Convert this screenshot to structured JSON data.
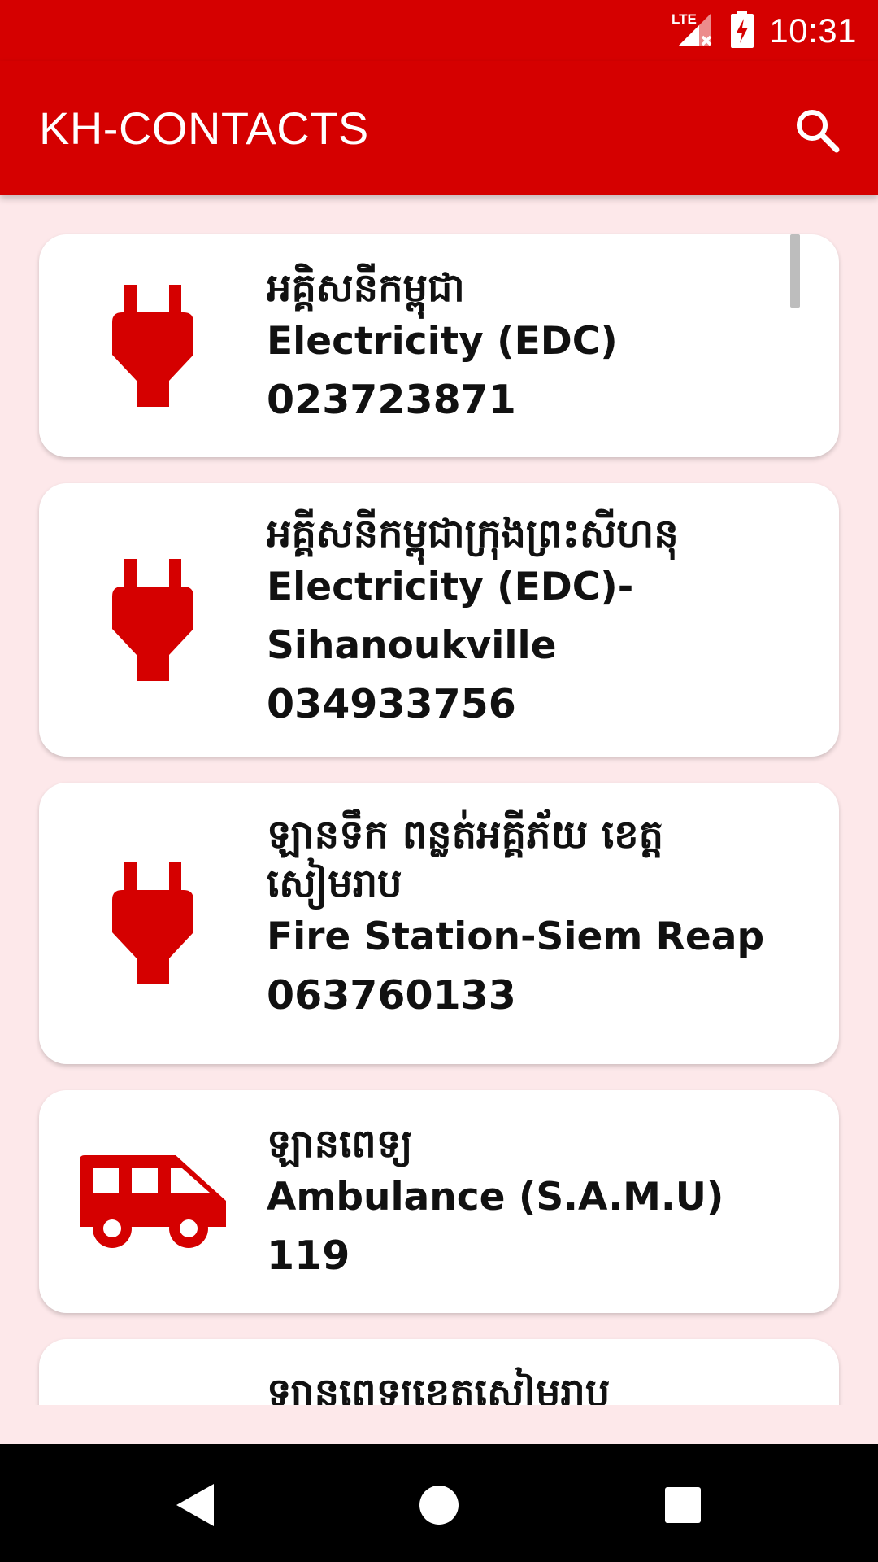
{
  "status_bar": {
    "network": "LTE",
    "time": "10:31"
  },
  "app_bar": {
    "title": "KH-CONTACTS",
    "search_icon": "search-icon"
  },
  "colors": {
    "primary": "#d50000",
    "background": "#fde8ea",
    "card": "#ffffff"
  },
  "contacts": [
    {
      "icon": "power-plug-icon",
      "kh": "អគ្គិសនីកម្ពុជា",
      "en": "Electricity (EDC)",
      "phone": "023723871"
    },
    {
      "icon": "power-plug-icon",
      "kh": "អគ្គីសនីកម្ពុជាក្រុងព្រះសីហនុ",
      "en": "Electricity (EDC)-Sihanoukville",
      "phone": "034933756"
    },
    {
      "icon": "power-plug-icon",
      "kh": "ឡានទឹក ពន្លត់អគ្គីភ័យ ខេត្តសៀមរាប",
      "en": "Fire Station-Siem Reap",
      "phone": "063760133"
    },
    {
      "icon": "ambulance-icon",
      "kh": "ឡានពេទ្យ",
      "en": "Ambulance (S.A.M.U)",
      "phone": "119"
    },
    {
      "icon": "",
      "kh": "ឡានពេទ្យខេត្តសៀមរាប",
      "en": "",
      "phone": ""
    }
  ],
  "nav_bar": {
    "back": "back-icon",
    "home": "home-icon",
    "recents": "recents-icon"
  }
}
